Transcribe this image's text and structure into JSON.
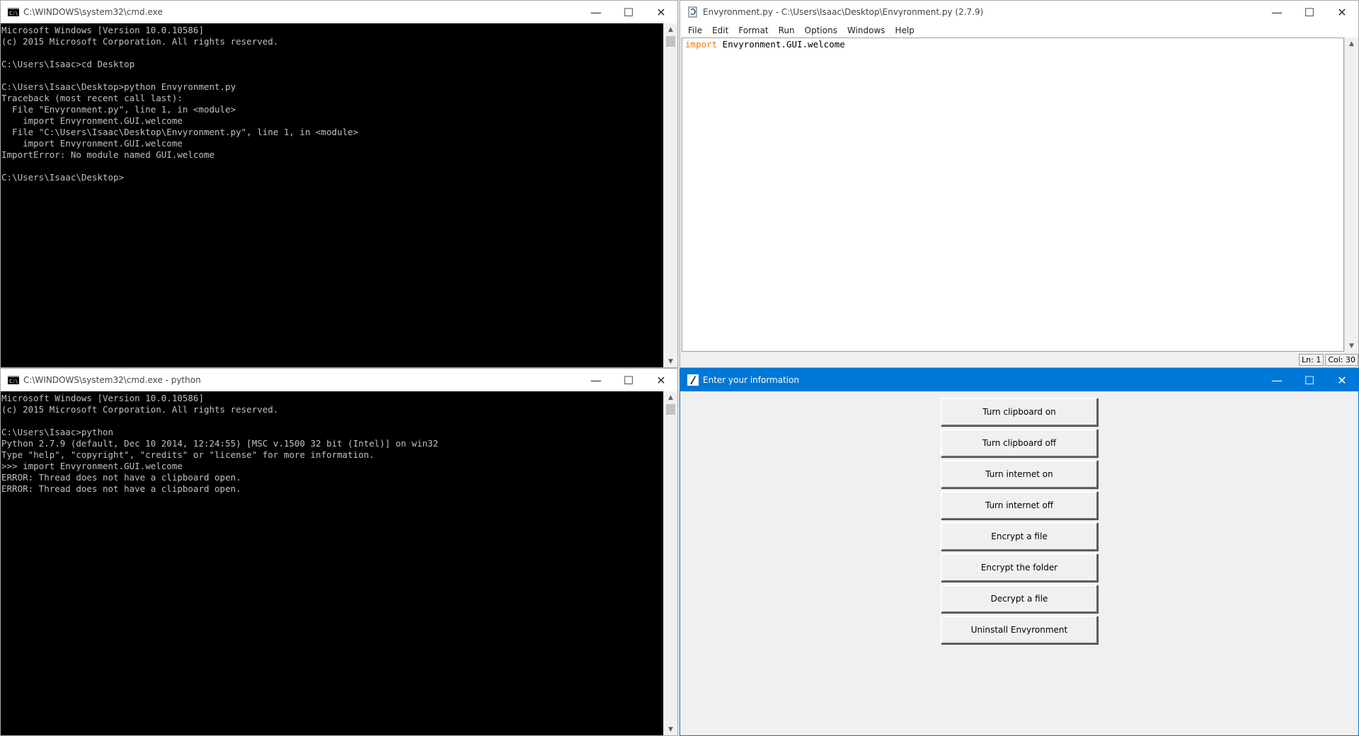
{
  "windows": {
    "cmd1": {
      "title": "C:\\WINDOWS\\system32\\cmd.exe",
      "lines": [
        "Microsoft Windows [Version 10.0.10586]",
        "(c) 2015 Microsoft Corporation. All rights reserved.",
        "",
        "C:\\Users\\Isaac>cd Desktop",
        "",
        "C:\\Users\\Isaac\\Desktop>python Envyronment.py",
        "Traceback (most recent call last):",
        "  File \"Envyronment.py\", line 1, in <module>",
        "    import Envyronment.GUI.welcome",
        "  File \"C:\\Users\\Isaac\\Desktop\\Envyronment.py\", line 1, in <module>",
        "    import Envyronment.GUI.welcome",
        "ImportError: No module named GUI.welcome",
        "",
        "C:\\Users\\Isaac\\Desktop>"
      ]
    },
    "idle": {
      "title": "Envyronment.py - C:\\Users\\Isaac\\Desktop\\Envyronment.py (2.7.9)",
      "menu": [
        "File",
        "Edit",
        "Format",
        "Run",
        "Options",
        "Windows",
        "Help"
      ],
      "code_keyword": "import",
      "code_rest": " Envyronment.GUI.welcome",
      "status_ln": "Ln: 1",
      "status_col": "Col: 30",
      "keyword_color": "#ff7700"
    },
    "cmd2": {
      "title": "C:\\WINDOWS\\system32\\cmd.exe - python",
      "lines": [
        "Microsoft Windows [Version 10.0.10586]",
        "(c) 2015 Microsoft Corporation. All rights reserved.",
        "",
        "C:\\Users\\Isaac>python",
        "Python 2.7.9 (default, Dec 10 2014, 12:24:55) [MSC v.1500 32 bit (Intel)] on win32",
        "Type \"help\", \"copyright\", \"credits\" or \"license\" for more information.",
        ">>> import Envyronment.GUI.welcome",
        "ERROR: Thread does not have a clipboard open.",
        "ERROR: Thread does not have a clipboard open."
      ]
    },
    "tk": {
      "title": "Enter your information",
      "titlebar_color": "#0078d7",
      "buttons": [
        "Turn clipboard on",
        "Turn clipboard off",
        "Turn internet on",
        "Turn internet off",
        "Encrypt a file",
        "Encrypt the folder",
        "Decrypt a file",
        "Uninstall Envyronment"
      ]
    }
  },
  "caption": {
    "minimize": "—",
    "maximize": "☐",
    "close": "✕"
  }
}
